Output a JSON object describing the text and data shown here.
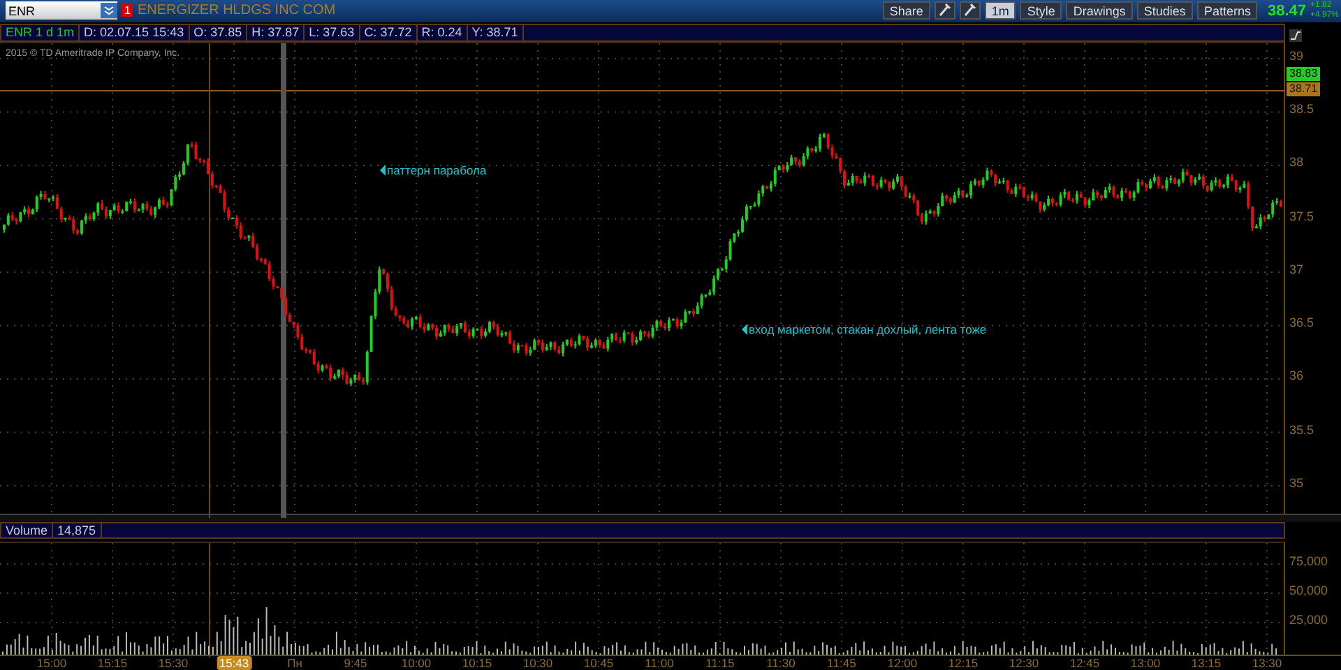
{
  "toolbar": {
    "symbol": "ENR",
    "alert_badge": "1",
    "company": "ENERGIZER HLDGS INC COM",
    "buttons": [
      {
        "kind": "text",
        "label": "Share"
      },
      {
        "kind": "icon"
      },
      {
        "kind": "icon"
      },
      {
        "kind": "chip",
        "label": "1m"
      },
      {
        "kind": "text",
        "label": "Style"
      },
      {
        "kind": "text",
        "label": "Drawings"
      },
      {
        "kind": "text",
        "label": "Studies"
      },
      {
        "kind": "text",
        "label": "Patterns"
      }
    ],
    "last_price": "38.47",
    "change": "+1.82",
    "change_pct": "+4.97%"
  },
  "info_bar": [
    "ENR 1 d 1m",
    "D: 02.07.15 15:43",
    "O: 37.85",
    "H: 37.87",
    "L: 37.63",
    "C: 37.72",
    "R: 0.24",
    "Y: 38.71"
  ],
  "copyright": "2015 © TD Ameritrade IP Company, Inc.",
  "price_axis": [
    "39",
    "38.5",
    "38",
    "37.5",
    "37",
    "36.5",
    "36",
    "35.5",
    "35"
  ],
  "price_markers": [
    {
      "label": "38.83",
      "color": "#22cc22"
    },
    {
      "label": "38.71",
      "color": "#a8761c"
    }
  ],
  "annotations": [
    {
      "text": "паттерн парабола"
    },
    {
      "text": "вход маркетом, стакан дохлый, лента тоже"
    }
  ],
  "volume": {
    "title": "Volume",
    "value": "14,875",
    "axis": [
      "75,000",
      "50,000",
      "25,000"
    ]
  },
  "time_axis": [
    {
      "label": "15:00",
      "highlighted": false
    },
    {
      "label": "15:15",
      "highlighted": false
    },
    {
      "label": "15:30",
      "highlighted": false
    },
    {
      "label": "15:43",
      "highlighted": true
    },
    {
      "label": "Пн",
      "highlighted": false
    },
    {
      "label": "9:45",
      "highlighted": false
    },
    {
      "label": "10:00",
      "highlighted": false
    },
    {
      "label": "10:15",
      "highlighted": false
    },
    {
      "label": "10:30",
      "highlighted": false
    },
    {
      "label": "10:45",
      "highlighted": false
    },
    {
      "label": "11:00",
      "highlighted": false
    },
    {
      "label": "11:15",
      "highlighted": false
    },
    {
      "label": "11:30",
      "highlighted": false
    },
    {
      "label": "11:45",
      "highlighted": false
    },
    {
      "label": "12:00",
      "highlighted": false
    },
    {
      "label": "12:15",
      "highlighted": false
    },
    {
      "label": "12:30",
      "highlighted": false
    },
    {
      "label": "12:45",
      "highlighted": false
    },
    {
      "label": "13:00",
      "highlighted": false
    },
    {
      "label": "13:15",
      "highlighted": false
    },
    {
      "label": "13:30",
      "highlighted": false
    }
  ]
}
